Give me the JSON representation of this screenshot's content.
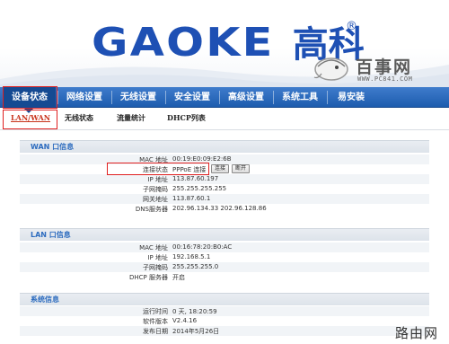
{
  "brand": {
    "logo_text": "GAOKE",
    "logo_cn": "高科",
    "registered": "®",
    "watermark_cn": "百事网",
    "watermark_url": "WWW.PC841.COM",
    "footer_watermark": "路由网",
    "color": "#1e50b4"
  },
  "nav": {
    "items": [
      {
        "label": "设备状态",
        "active": true
      },
      {
        "label": "网络设置"
      },
      {
        "label": "无线设置"
      },
      {
        "label": "安全设置"
      },
      {
        "label": "高级设置"
      },
      {
        "label": "系统工具"
      },
      {
        "label": "易安装"
      }
    ]
  },
  "subnav": {
    "items": [
      {
        "label": "LAN/WAN",
        "active": true
      },
      {
        "label": "无线状态"
      },
      {
        "label": "流量统计"
      },
      {
        "label": "DHCP列表"
      }
    ]
  },
  "wan": {
    "title": "WAN 口信息",
    "rows": [
      {
        "label": "MAC 地址",
        "value": "00:19:E0:09:E2:6B"
      },
      {
        "label": "连接状态",
        "value": "PPPoE 连接"
      },
      {
        "label": "IP 地址",
        "value": "113.87.60.197"
      },
      {
        "label": "子网掩码",
        "value": "255.255.255.255"
      },
      {
        "label": "网关地址",
        "value": "113.87.60.1"
      },
      {
        "label": "DNS服务器",
        "value": "202.96.134.33 202.96.128.86"
      }
    ],
    "connect_button": "连接",
    "disconnect_button": "断开"
  },
  "lan": {
    "title": "LAN 口信息",
    "rows": [
      {
        "label": "MAC 地址",
        "value": "00:16:78:20:B0:AC"
      },
      {
        "label": "IP 地址",
        "value": "192.168.5.1"
      },
      {
        "label": "子网掩码",
        "value": "255.255.255.0"
      },
      {
        "label": "DHCP 服务器",
        "value": "开启"
      }
    ]
  },
  "system": {
    "title": "系统信息",
    "rows": [
      {
        "label": "运行时间",
        "value": "0 天, 18:20:59"
      },
      {
        "label": "软件版本",
        "value": "V2.4.16"
      },
      {
        "label": "发布日期",
        "value": "2014年5月26日"
      }
    ]
  }
}
